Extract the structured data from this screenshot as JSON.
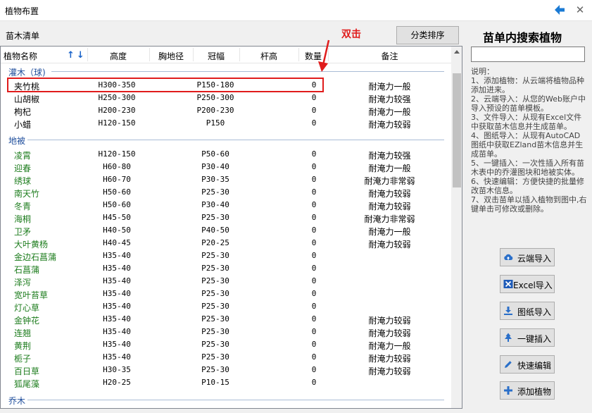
{
  "window": {
    "title": "植物布置"
  },
  "list_label": "苗木清单",
  "sort_button": "分类排序",
  "columns": [
    "植物名称",
    "高度",
    "胸地径",
    "冠幅",
    "杆高",
    "数量",
    "备注"
  ],
  "groups": [
    {
      "label": "灌木（球)"
    },
    {
      "label": "地被"
    },
    {
      "label": "乔木"
    }
  ],
  "rows": [
    {
      "name": "夹竹桃",
      "height": "H300-350",
      "crown": "P150-180",
      "qty": "0",
      "note": "耐淹力一般"
    },
    {
      "name": "山胡椒",
      "height": "H250-300",
      "crown": "P250-300",
      "qty": "0",
      "note": "耐淹力较强"
    },
    {
      "name": "枸杞",
      "height": "H200-230",
      "crown": "P200-230",
      "qty": "0",
      "note": "耐淹力一般"
    },
    {
      "name": "小蜡",
      "height": "H120-150",
      "crown": "P150",
      "qty": "0",
      "note": "耐淹力较弱"
    },
    {
      "name": "凌霄",
      "height": "H120-150",
      "crown": "P50-60",
      "qty": "0",
      "note": "耐淹力较强"
    },
    {
      "name": "迎春",
      "height": "H60-80",
      "crown": "P30-40",
      "qty": "0",
      "note": "耐淹力一般"
    },
    {
      "name": "绣球",
      "height": "H60-70",
      "crown": "P30-35",
      "qty": "0",
      "note": "耐淹力非常弱"
    },
    {
      "name": "南天竹",
      "height": "H50-60",
      "crown": "P25-30",
      "qty": "0",
      "note": "耐淹力较弱"
    },
    {
      "name": "冬青",
      "height": "H50-60",
      "crown": "P30-40",
      "qty": "0",
      "note": "耐淹力较弱"
    },
    {
      "name": "海桐",
      "height": "H45-50",
      "crown": "P25-30",
      "qty": "0",
      "note": "耐淹力非常弱"
    },
    {
      "name": "卫矛",
      "height": "H40-50",
      "crown": "P40-50",
      "qty": "0",
      "note": "耐淹力一般"
    },
    {
      "name": "大叶黄杨",
      "height": "H40-45",
      "crown": "P20-25",
      "qty": "0",
      "note": "耐淹力较弱"
    },
    {
      "name": "金边石菖蒲",
      "height": "H35-40",
      "crown": "P25-30",
      "qty": "0",
      "note": ""
    },
    {
      "name": "石菖蒲",
      "height": "H35-40",
      "crown": "P25-30",
      "qty": "0",
      "note": ""
    },
    {
      "name": "泽泻",
      "height": "H35-40",
      "crown": "P25-30",
      "qty": "0",
      "note": ""
    },
    {
      "name": "宽叶苔草",
      "height": "H35-40",
      "crown": "P25-30",
      "qty": "0",
      "note": ""
    },
    {
      "name": "灯心草",
      "height": "H35-40",
      "crown": "P25-30",
      "qty": "0",
      "note": ""
    },
    {
      "name": "金钟花",
      "height": "H35-40",
      "crown": "P25-30",
      "qty": "0",
      "note": "耐淹力较弱"
    },
    {
      "name": "连翘",
      "height": "H35-40",
      "crown": "P25-30",
      "qty": "0",
      "note": "耐淹力较弱"
    },
    {
      "name": "黄荆",
      "height": "H35-40",
      "crown": "P25-30",
      "qty": "0",
      "note": "耐淹力一般"
    },
    {
      "name": "栀子",
      "height": "H35-40",
      "crown": "P25-30",
      "qty": "0",
      "note": "耐淹力较弱"
    },
    {
      "name": "百日草",
      "height": "H30-35",
      "crown": "P25-30",
      "qty": "0",
      "note": "耐淹力较弱"
    },
    {
      "name": "狐尾藻",
      "height": "H20-25",
      "crown": "P10-15",
      "qty": "0",
      "note": ""
    }
  ],
  "annotation": "双击",
  "right_panel": {
    "title": "苗单内搜索植物",
    "search_value": "",
    "help": [
      "说明：",
      "1、添加植物：从云端将植物品种添加进来。",
      "2、云端导入：从您的Web账户中导入预设的苗单模板。",
      "3、文件导入：从现有Excel文件中获取苗木信息并生成苗单。",
      "4、图纸导入：从现有AutoCAD图纸中获取EZland苗木信息并生成苗单。",
      "5、一键插入：一次性插入所有苗木表中的乔灌图块和地被实体。",
      "6、快速编辑：方便快捷的批量修改苗木信息。",
      "7、双击苗单以插入植物到图中,右键单击可修改或删除。"
    ],
    "buttons": [
      "云端导入",
      "Excel导入",
      "图纸导入",
      "一键插入",
      "快速编辑",
      "添加植物"
    ]
  },
  "colors": {
    "accent": "#1a63c9",
    "annotation": "#e01c1c",
    "green_text": "#1e7d1e",
    "group_text": "#1f4e9c"
  }
}
